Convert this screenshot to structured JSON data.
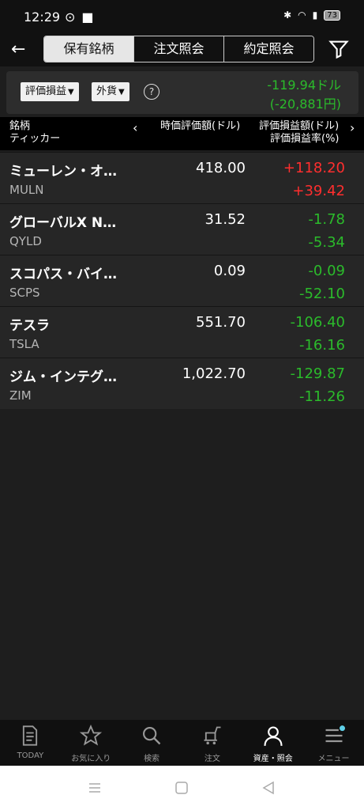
{
  "status": {
    "time": "12:29",
    "battery": "73"
  },
  "tabs": [
    "保有銘柄",
    "注文照会",
    "約定照会"
  ],
  "summary": {
    "select1": "評価損益",
    "select2": "外貨",
    "total_usd": "-119.94ドル",
    "total_jpy": "(-20,881円)"
  },
  "columns": {
    "name": "銘柄",
    "ticker": "ティッカー",
    "price": "時価評価額(ドル)",
    "pl": "評価損益額(ドル)",
    "rate": "評価損益率(%)"
  },
  "rows": [
    {
      "name": "ミューレン・オ…",
      "ticker": "MULN",
      "price": "418.00",
      "pl": "+118.20",
      "rate": "+39.42",
      "sign": "pos"
    },
    {
      "name": "グローバルX N…",
      "ticker": "QYLD",
      "price": "31.52",
      "pl": "-1.78",
      "rate": "-5.34",
      "sign": "neg"
    },
    {
      "name": "スコパス・バイ…",
      "ticker": "SCPS",
      "price": "0.09",
      "pl": "-0.09",
      "rate": "-52.10",
      "sign": "neg"
    },
    {
      "name": "テスラ",
      "ticker": "TSLA",
      "price": "551.70",
      "pl": "-106.40",
      "rate": "-16.16",
      "sign": "neg"
    },
    {
      "name": "ジム・インテグ…",
      "ticker": "ZIM",
      "price": "1,022.70",
      "pl": "-129.87",
      "rate": "-11.26",
      "sign": "neg"
    }
  ],
  "nav": [
    {
      "label": "TODAY",
      "icon": "document-icon"
    },
    {
      "label": "お気に入り",
      "icon": "star-icon"
    },
    {
      "label": "検索",
      "icon": "search-icon"
    },
    {
      "label": "注文",
      "icon": "cart-icon"
    },
    {
      "label": "資産・照会",
      "icon": "person-icon",
      "active": true
    },
    {
      "label": "メニュー",
      "icon": "menu-icon"
    }
  ],
  "colors": {
    "positive": "#ff2e2e",
    "negative": "#2bbb2b",
    "background": "#1e1e1e"
  }
}
